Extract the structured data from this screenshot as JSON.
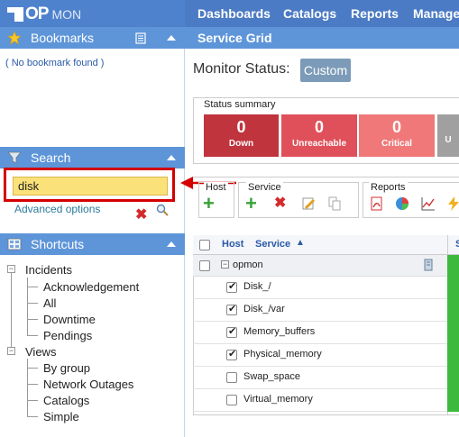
{
  "topnav": {
    "logo_op": "OP",
    "logo_mon": "MON",
    "items": [
      "Dashboards",
      "Catalogs",
      "Reports",
      "Manager"
    ]
  },
  "bookmarks": {
    "title": "Bookmarks",
    "empty": "( No bookmark found )"
  },
  "search": {
    "title": "Search",
    "value": "disk",
    "advanced": "Advanced options"
  },
  "shortcuts": {
    "title": "Shortcuts",
    "groups": [
      {
        "label": "Incidents",
        "children": [
          "Acknowledgement",
          "All",
          "Downtime",
          "Pendings"
        ]
      },
      {
        "label": "Views",
        "children": [
          "By group",
          "Network Outages",
          "Catalogs",
          "Simple"
        ]
      }
    ]
  },
  "main": {
    "header": "Service Grid",
    "monitor_status_label": "Monitor Status:",
    "monitor_status_value": "Custom",
    "status_summary": {
      "title": "Status summary",
      "tiles": [
        {
          "count": "0",
          "label": "Down",
          "color": "#c0343e"
        },
        {
          "count": "0",
          "label": "Unreachable",
          "color": "#e0505a"
        },
        {
          "count": "0",
          "label": "Critical",
          "color": "#f07878"
        },
        {
          "count": "",
          "label": "U",
          "color": "#a0a0a0"
        }
      ]
    },
    "toolbar": {
      "host_label": "Host",
      "service_label": "Service",
      "reports_label": "Reports"
    },
    "grid": {
      "col_host": "Host",
      "col_service": "Service",
      "col_status": "S",
      "group": "opmon",
      "rows": [
        {
          "name": "Disk_/",
          "checked": true
        },
        {
          "name": "Disk_/var",
          "checked": true
        },
        {
          "name": "Memory_buffers",
          "checked": true
        },
        {
          "name": "Physical_memory",
          "checked": true
        },
        {
          "name": "Swap_space",
          "checked": false
        },
        {
          "name": "Virtual_memory",
          "checked": false
        }
      ]
    }
  },
  "colors": {
    "topbar": "#4b7bc4",
    "panel_header": "#5e95d9",
    "highlight": "#d40000",
    "search_bg": "#fbe17a",
    "ok": "#3dba3d"
  }
}
